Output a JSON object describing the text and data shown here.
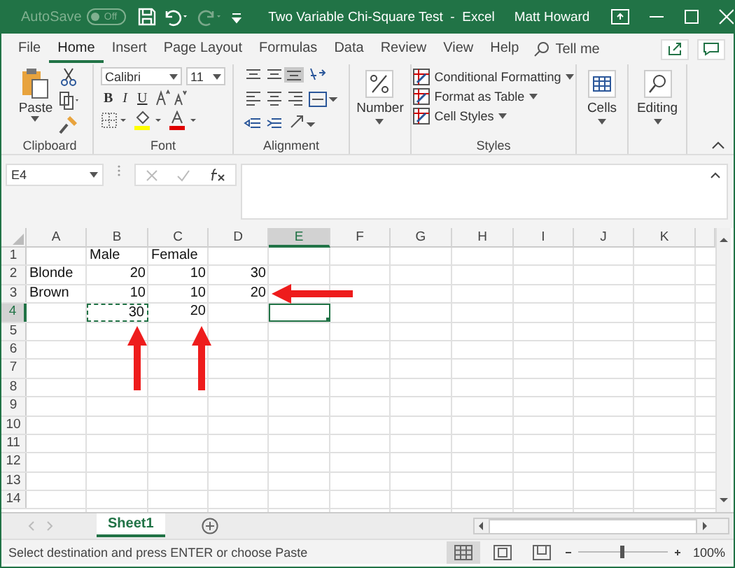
{
  "title_bar": {
    "autosave": "AutoSave",
    "autosave_toggle": "Off",
    "title": "Two Variable Chi-Square Test  -  Excel",
    "user": "Matt Howard"
  },
  "menu_tabs": [
    {
      "label": "File",
      "selected": false
    },
    {
      "label": "Home",
      "selected": true
    },
    {
      "label": "Insert",
      "selected": false
    },
    {
      "label": "Page Layout",
      "selected": false
    },
    {
      "label": "Formulas",
      "selected": false
    },
    {
      "label": "Data",
      "selected": false
    },
    {
      "label": "Review",
      "selected": false
    },
    {
      "label": "View",
      "selected": false
    },
    {
      "label": "Help",
      "selected": false
    }
  ],
  "tell_me": "Tell me",
  "ribbon": {
    "clipboard": {
      "paste": "Paste",
      "label": "Clipboard"
    },
    "font": {
      "name": "Calibri",
      "size": "11",
      "bold": "B",
      "italic": "I",
      "underline": "U",
      "label": "Font"
    },
    "alignment": {
      "label": "Alignment"
    },
    "number": {
      "button": "Number"
    },
    "styles": {
      "items": [
        "Conditional Formatting",
        "Format as Table",
        "Cell Styles"
      ],
      "label": "Styles"
    },
    "cells": {
      "button": "Cells"
    },
    "editing": {
      "button": "Editing"
    }
  },
  "name_box": "E4",
  "columns": [
    {
      "label": "A",
      "selected": false
    },
    {
      "label": "B",
      "selected": false
    },
    {
      "label": "C",
      "selected": false
    },
    {
      "label": "D",
      "selected": false
    },
    {
      "label": "E",
      "selected": true
    },
    {
      "label": "F",
      "selected": false
    },
    {
      "label": "G",
      "selected": false
    },
    {
      "label": "H",
      "selected": false
    },
    {
      "label": "I",
      "selected": false
    },
    {
      "label": "J",
      "selected": false
    },
    {
      "label": "K",
      "selected": false
    }
  ],
  "rows": [
    {
      "label": "1",
      "selected": false,
      "cells": [
        null,
        {
          "text": "Male",
          "kind": "text"
        },
        {
          "text": "Female",
          "kind": "text"
        },
        null,
        null,
        null,
        null,
        null,
        null,
        null,
        null
      ]
    },
    {
      "label": "2",
      "selected": false,
      "cells": [
        {
          "text": "Blonde",
          "kind": "text"
        },
        {
          "text": "20",
          "kind": "number"
        },
        {
          "text": "10",
          "kind": "number"
        },
        {
          "text": "30",
          "kind": "number"
        },
        null,
        null,
        null,
        null,
        null,
        null,
        null
      ]
    },
    {
      "label": "3",
      "selected": false,
      "cells": [
        {
          "text": "Brown",
          "kind": "text"
        },
        {
          "text": "10",
          "kind": "number"
        },
        {
          "text": "10",
          "kind": "number"
        },
        {
          "text": "20",
          "kind": "number"
        },
        null,
        null,
        null,
        null,
        null,
        null,
        null
      ]
    },
    {
      "label": "4",
      "selected": true,
      "cells": [
        null,
        {
          "text": "30",
          "kind": "number",
          "copied": true
        },
        {
          "text": "20",
          "kind": "number"
        },
        null,
        {
          "kind": "empty",
          "active": true
        },
        null,
        null,
        null,
        null,
        null,
        null
      ]
    },
    {
      "label": "5",
      "selected": false,
      "cells": []
    },
    {
      "label": "6",
      "selected": false,
      "cells": []
    },
    {
      "label": "7",
      "selected": false,
      "cells": []
    },
    {
      "label": "8",
      "selected": false,
      "cells": []
    },
    {
      "label": "9",
      "selected": false,
      "cells": []
    },
    {
      "label": "10",
      "selected": false,
      "cells": []
    },
    {
      "label": "11",
      "selected": false,
      "cells": []
    },
    {
      "label": "12",
      "selected": false,
      "cells": []
    },
    {
      "label": "13",
      "selected": false,
      "cells": []
    },
    {
      "label": "14",
      "selected": false,
      "cells": []
    }
  ],
  "sheet_tabs": [
    {
      "label": "Sheet1",
      "selected": true
    }
  ],
  "status_bar": {
    "message": "Select destination and press ENTER or choose Paste",
    "zoom": "100%",
    "zoom_slider": {
      "level": 0.5
    }
  }
}
